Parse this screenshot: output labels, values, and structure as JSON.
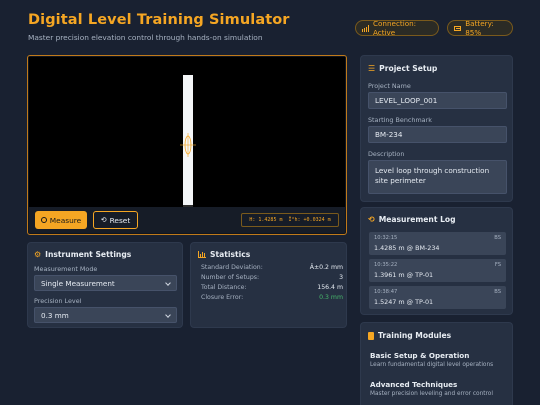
{
  "header": {
    "title": "Digital Level Training Simulator",
    "subtitle": "Master precision elevation control through hands-on simulation",
    "connection": "Connection: Active",
    "battery": "Battery: 85%"
  },
  "simulator": {
    "measure_label": "Measure",
    "reset_label": "Reset",
    "readout_height": "H: 1.4285 m",
    "readout_tilt": "Î°h: +0.0324 m"
  },
  "instrument_settings": {
    "title": "Instrument Settings",
    "mode_label": "Measurement Mode",
    "mode_value": "Single Measurement",
    "precision_label": "Precision Level",
    "precision_value": "0.3 mm"
  },
  "statistics": {
    "title": "Statistics",
    "rows": [
      {
        "label": "Standard Deviation:",
        "value": "Â±0.2 mm"
      },
      {
        "label": "Number of Setups:",
        "value": "3"
      },
      {
        "label": "Total Distance:",
        "value": "156.4 m"
      },
      {
        "label": "Closure Error:",
        "value": "0.3 mm"
      }
    ]
  },
  "project_setup": {
    "title": "Project Setup",
    "name_label": "Project Name",
    "name_value": "LEVEL_LOOP_001",
    "benchmark_label": "Starting Benchmark",
    "benchmark_value": "BM-234",
    "description_label": "Description",
    "description_value": "Level loop through construction site perimeter"
  },
  "measurement_log": {
    "title": "Measurement Log",
    "entries": [
      {
        "time": "10:32:15",
        "tag": "BS",
        "reading": "1.4285 m @ BM-234"
      },
      {
        "time": "10:35:22",
        "tag": "FS",
        "reading": "1.3961 m @ TP-01"
      },
      {
        "time": "10:38:47",
        "tag": "BS",
        "reading": "1.5247 m @ TP-01"
      }
    ]
  },
  "training_modules": {
    "title": "Training Modules",
    "modules": [
      {
        "title": "Basic Setup & Operation",
        "desc": "Learn fundamental digital level operations"
      },
      {
        "title": "Advanced Techniques",
        "desc": "Master precision leveling and error control"
      }
    ]
  },
  "colors": {
    "accent": "#f5a623",
    "background": "#192131",
    "panel": "#263042",
    "success": "#47b86b"
  }
}
